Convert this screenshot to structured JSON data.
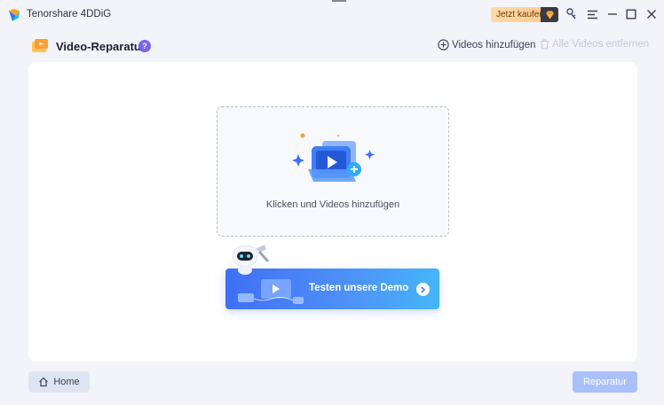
{
  "titlebar": {
    "app_name": "Tenorshare 4DDiG",
    "buy_label": "Jetzt kaufen",
    "icons": [
      "key-icon",
      "menu-icon",
      "minimize-icon",
      "maximize-icon",
      "close-icon"
    ]
  },
  "header": {
    "title": "Video-Reparatur",
    "help_label": "?",
    "add_videos_label": "Videos hinzufügen",
    "remove_all_label": "Alle Videos entfernen"
  },
  "dropzone": {
    "label": "Klicken und Videos hinzufügen"
  },
  "demo": {
    "label": "Testen unsere Demo"
  },
  "footer": {
    "home_label": "Home",
    "repair_label": "Reparatur"
  },
  "colors": {
    "accent": "#3f6ff5",
    "help_badge": "#7a63f0",
    "repair_disabled": "#a9c0fb",
    "buy_orange": "#ffc986"
  }
}
